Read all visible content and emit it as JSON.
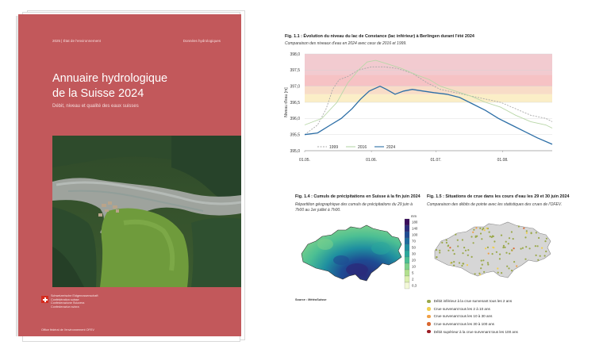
{
  "cover": {
    "header_left": "2025 | État de l'environnement",
    "header_right": "Données hydrologiques",
    "title_line1": "Annuaire hydrologique",
    "title_line2": "de la Suisse 2024",
    "subtitle": "Débit, niveau et qualité des eaux suisses",
    "confederation": [
      "Schweizerische Eidgenossenschaft",
      "Confédération suisse",
      "Confederazione Svizzera",
      "Confederaziun svizra"
    ],
    "office": "Office fédéral de l'environnement OFEV",
    "color": "#c2585b"
  },
  "fig11": {
    "title": "Fig. 1.1 : Évolution du niveau du lac de Constance (lac inférieur) à Berlingen durant l'été 2024",
    "subtitle": "Comparaison des niveaux d'eau en 2024 avec ceux de 2016 et 1999.",
    "chart_data": {
      "type": "line",
      "ylabel": "Niveau d'eau [m]",
      "xlabel": "",
      "ylim": [
        395.0,
        398.0
      ],
      "y_ticks": [
        "398,0",
        "397,5",
        "397,0",
        "396,5",
        "396,0",
        "395,5",
        "395,0"
      ],
      "y_tick_values": [
        398.0,
        397.5,
        397.0,
        396.5,
        396.0,
        395.5,
        395.0
      ],
      "x_ticks": [
        "01.05.",
        "01.06.",
        "01.07.",
        "01.08."
      ],
      "x_tick_days": [
        0,
        31,
        61,
        92
      ],
      "x_range_days": [
        0,
        115
      ],
      "bands": [
        {
          "from": 397.35,
          "to": 398.0,
          "color": "#f2cbd0"
        },
        {
          "from": 397.0,
          "to": 397.35,
          "color": "#f6c2c4"
        },
        {
          "from": 396.75,
          "to": 397.0,
          "color": "#f8dcc7"
        },
        {
          "from": 396.5,
          "to": 396.75,
          "color": "#fbeec7"
        }
      ],
      "series": [
        {
          "name": "1999",
          "color": "#a8a8a8",
          "dash": "2,1.5",
          "x": [
            0,
            6,
            10,
            13,
            16,
            20,
            25,
            31,
            37,
            43,
            50,
            57,
            63,
            70,
            77,
            84,
            91,
            98,
            105,
            112,
            115
          ],
          "y": [
            395.5,
            395.8,
            396.3,
            396.9,
            397.2,
            397.3,
            397.5,
            397.6,
            397.6,
            397.55,
            397.4,
            397.1,
            396.9,
            396.8,
            396.7,
            396.6,
            396.5,
            396.3,
            396.1,
            396.0,
            395.9
          ]
        },
        {
          "name": "2016",
          "color": "#b9d7a8",
          "dash": "",
          "x": [
            0,
            8,
            15,
            20,
            25,
            29,
            33,
            38,
            45,
            52,
            58,
            63,
            70,
            77,
            84,
            91,
            98,
            105,
            112,
            115
          ],
          "y": [
            395.8,
            396.0,
            396.5,
            397.1,
            397.5,
            397.75,
            397.8,
            397.7,
            397.55,
            397.35,
            397.2,
            397.0,
            396.85,
            396.7,
            396.5,
            396.35,
            396.1,
            395.9,
            395.8,
            395.7
          ]
        },
        {
          "name": "2024",
          "color": "#2c6ea6",
          "dash": "",
          "x": [
            0,
            6,
            12,
            17,
            22,
            26,
            30,
            35,
            38,
            42,
            46,
            50,
            55,
            60,
            66,
            72,
            78,
            84,
            90,
            96,
            102,
            108,
            115
          ],
          "y": [
            395.5,
            395.55,
            395.8,
            396.0,
            396.3,
            396.6,
            396.85,
            397.0,
            396.9,
            396.75,
            396.85,
            396.9,
            396.85,
            396.8,
            396.75,
            396.65,
            396.45,
            396.25,
            396.0,
            395.8,
            395.6,
            395.4,
            395.2
          ]
        }
      ],
      "legend_placement": "bottom-left",
      "grid": true
    }
  },
  "fig14": {
    "title": "Fig. 1.4 : Cumuls de précipitations en Suisse à la fin juin 2024",
    "subtitle": "Répartition géographique des cumuls de précipitations du 29 juin à 7h00 au 1er juillet à 7h00.",
    "unit": "mm",
    "scale_labels": [
      "180",
      "140",
      "100",
      "70",
      "50",
      "30",
      "20",
      "10",
      "5",
      "2",
      "0,3"
    ],
    "scale_colors": [
      "#3a0d5c",
      "#2a2b7a",
      "#1e4b93",
      "#1d6c9e",
      "#1f8fa0",
      "#2aa89c",
      "#4cbf93",
      "#7fd18b",
      "#b3e08e",
      "#dcefb0",
      "#f3f8d8"
    ],
    "source": "Source : MétéoSuisse"
  },
  "fig15": {
    "title": "Fig. 1.5 : Situations de crue dans les cours d'eau les 29 et 30 juin 2024",
    "subtitle": "Comparaison des débits de pointe avec les statistiques des crues de l'OFEV.",
    "legend": [
      {
        "label": "Débit inférieur à la crue survenant tous les 2 ans",
        "color": "#9aa84a"
      },
      {
        "label": "Crue survenant tous les 2 à 10 ans",
        "color": "#f0cf4e"
      },
      {
        "label": "Crue survenant tous les 10 à 30 ans",
        "color": "#f0a046"
      },
      {
        "label": "Crue survenant tous les 30 à 100 ans",
        "color": "#d9672f"
      },
      {
        "label": "Débit supérieur à la crue survenant tous les 100 ans",
        "color": "#9c1d24"
      }
    ]
  }
}
